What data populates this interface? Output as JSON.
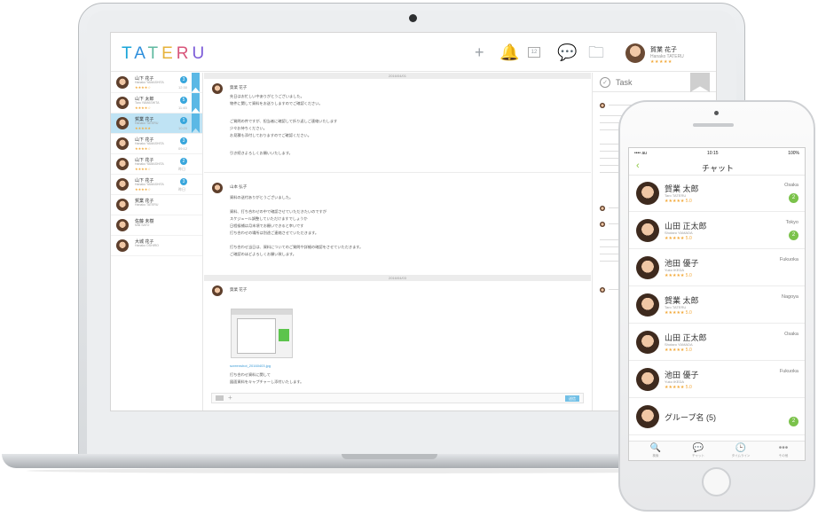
{
  "laptop": {
    "logo": [
      "T",
      "A",
      "T",
      "E",
      "R",
      "U"
    ],
    "header_icons": [
      "plus-icon",
      "bell-icon",
      "calendar-icon",
      "chat-icon",
      "folder-icon"
    ],
    "user": {
      "name": "賀業 花子",
      "sub": "Hanako TATERU",
      "stars": "★★★★★"
    },
    "contacts": [
      {
        "name": "山下 花子",
        "sub": "Hanako YAMASHITA",
        "stars": "★★★★☆",
        "badge": "3",
        "time": "12:30",
        "active": false,
        "bookmark": true
      },
      {
        "name": "山下 太郎",
        "sub": "Taro YAMASHITA",
        "stars": "★★★★☆",
        "badge": "5",
        "time": "11:45",
        "active": false,
        "bookmark": true
      },
      {
        "name": "賀業 花子",
        "sub": "Hanako TATERU",
        "stars": "★★★★★",
        "badge": "1",
        "time": "10:20",
        "active": true,
        "bookmark": true
      },
      {
        "name": "山下 花子",
        "sub": "Hanako YAMASHITA",
        "stars": "★★★★☆",
        "badge": "3",
        "time": "09:12",
        "active": false,
        "bookmark": false
      },
      {
        "name": "山下 花子",
        "sub": "Hanako YAMASHITA",
        "stars": "★★★★☆",
        "badge": "2",
        "time": "昨日",
        "active": false,
        "bookmark": false
      },
      {
        "name": "山下 花子",
        "sub": "Hanako YAMASHITA",
        "stars": "★★★★☆",
        "badge": "3",
        "time": "昨日",
        "active": false,
        "bookmark": false
      },
      {
        "name": "賀業 花子",
        "sub": "Hanako TATERU",
        "stars": "",
        "badge": "",
        "time": "",
        "active": false,
        "bookmark": false
      },
      {
        "name": "佐藤 未樹",
        "sub": "Miki SATO",
        "stars": "",
        "badge": "",
        "time": "",
        "active": false,
        "bookmark": false
      },
      {
        "name": "大城 花子",
        "sub": "Hanako OSHIRO",
        "stars": "",
        "badge": "",
        "time": "",
        "active": false,
        "bookmark": false
      }
    ],
    "chat": {
      "date1": "2016/04/01",
      "msg1": {
        "name": "賀業 花子",
        "lines": [
          "先日はお忙しい中ありがとうございました。",
          "物件に関して資料をお送りしますのでご確認ください。",
          "",
          "ご質問の件ですが、担当者に確認して折り返しご連絡いたします",
          "少々お待ちください。",
          "お見積も添付しておりますのでご確認ください。",
          "",
          "引き続きよろしくお願いいたします。"
        ]
      },
      "msg2": {
        "name": "山本 弘子",
        "lines": [
          "資料の送付ありがとうございました。",
          "",
          "資料、打ち合わせの中で確認させていただきたいのですが",
          "スケジュール調整していただけますでしょうか",
          "日程候補は月末頃でお願いできると幸いです",
          "打ち合わせの場所は別途ご連絡させていただきます。",
          "",
          "打ち合わせ当日は、資料についてのご質問や詳細の確認をさせていただきます。",
          "ご確認のほどよろしくお願い致します。"
        ]
      },
      "date2": "2016/04/03",
      "msg3": {
        "name": "賀業 花子",
        "link": "screenshot_20160403.jpg",
        "lines": [
          "打ち合わせ資料に関して",
          "図面資料をキャプチャーし添付いたします。"
        ]
      },
      "send_label": "送信"
    },
    "task": {
      "title": "Task"
    }
  },
  "phone": {
    "status": {
      "carrier": "•••• au",
      "time": "10:15",
      "battery": "100%"
    },
    "title": "チャット",
    "contacts": [
      {
        "name": "賀業 太郎",
        "sub": "Taro TATERU",
        "stars": "★★★★★ 5.0",
        "city": "Osaka",
        "badge": "2"
      },
      {
        "name": "山田 正太郎",
        "sub": "Shotaro YAMADA",
        "stars": "★★★★★ 5.0",
        "city": "Tokyo",
        "badge": "2"
      },
      {
        "name": "池田 優子",
        "sub": "Yuko IKEDA",
        "stars": "★★★★★ 5.0",
        "city": "Fukuoka",
        "badge": ""
      },
      {
        "name": "賀業 太郎",
        "sub": "Taro TATERU",
        "stars": "★★★★★ 5.0",
        "city": "Nagoya",
        "badge": ""
      },
      {
        "name": "山田 正太郎",
        "sub": "Shotaro YAMADA",
        "stars": "★★★★★ 5.0",
        "city": "Osaka",
        "badge": ""
      },
      {
        "name": "池田 優子",
        "sub": "Yuko IKEDA",
        "stars": "★★★★★ 5.0",
        "city": "Fukuoka",
        "badge": ""
      },
      {
        "name": "グループ名 (5)",
        "sub": "",
        "stars": "",
        "city": "",
        "badge": "2"
      }
    ],
    "tabs": [
      {
        "icon": "🔍",
        "label": "検索",
        "name": "search-icon"
      },
      {
        "icon": "💬",
        "label": "チャット",
        "name": "chat-icon"
      },
      {
        "icon": "🕒",
        "label": "タイムライン",
        "name": "clock-icon"
      },
      {
        "icon": "•••",
        "label": "その他",
        "name": "more-icon"
      }
    ]
  }
}
